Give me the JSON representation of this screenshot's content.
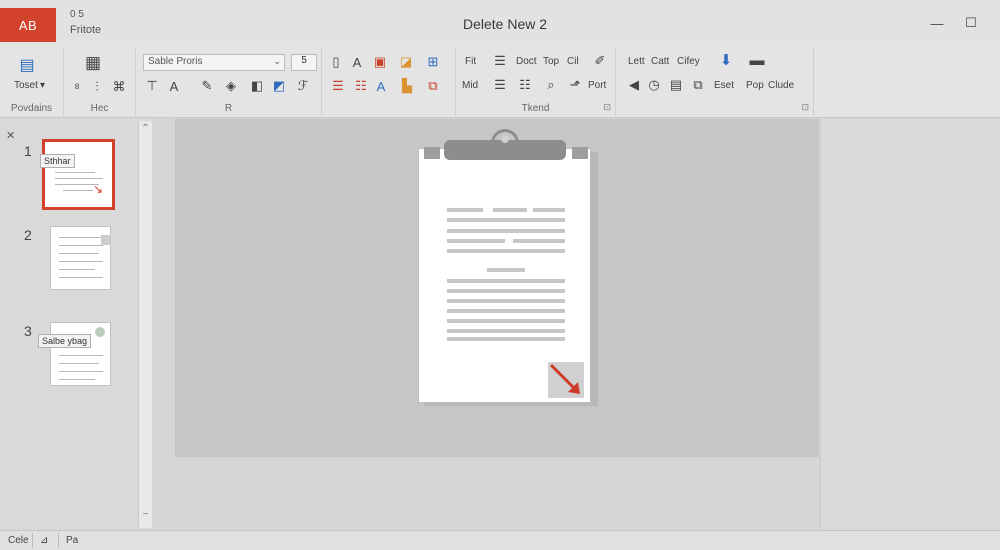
{
  "titlebar": {
    "app_badge": "AB",
    "qa_top": "0    5",
    "qa_bottom": "Fritote",
    "doc_title": "Delete New 2",
    "minimize": "—",
    "maximize": "☐",
    "close": "✕"
  },
  "ribbon": {
    "groups": {
      "g1_label": "Povdains",
      "g1_button": "Toset",
      "g2_label": "Hec",
      "g3_label": "R",
      "g4_label": "Tkend"
    },
    "font": {
      "name": "Sable Proris",
      "size": "5"
    },
    "text_row1": {
      "fit": "Fit",
      "doct": "Doct",
      "top": "Top",
      "cil": "Cil"
    },
    "text_row2": {
      "mid": "Mid",
      "port": "Port"
    },
    "right_row1": {
      "left": "Lett",
      "cart": "Catt",
      "cifey": "Cifey"
    },
    "right_row2": {
      "eset": "Eset",
      "pop": "Pop",
      "clude": "Clude"
    }
  },
  "thumbnails": [
    {
      "number": "1",
      "tooltip": "Sthhar"
    },
    {
      "number": "2",
      "tooltip": ""
    },
    {
      "number": "3",
      "tooltip": "Salbe ybag"
    }
  ],
  "pane": {
    "collapse": "✕"
  },
  "statusbar": {
    "left": "Cele",
    "pages": "Pa"
  },
  "colors": {
    "accent": "#d2412a",
    "canvas": "#c6c6c6",
    "arrow": "#d03a2a"
  }
}
